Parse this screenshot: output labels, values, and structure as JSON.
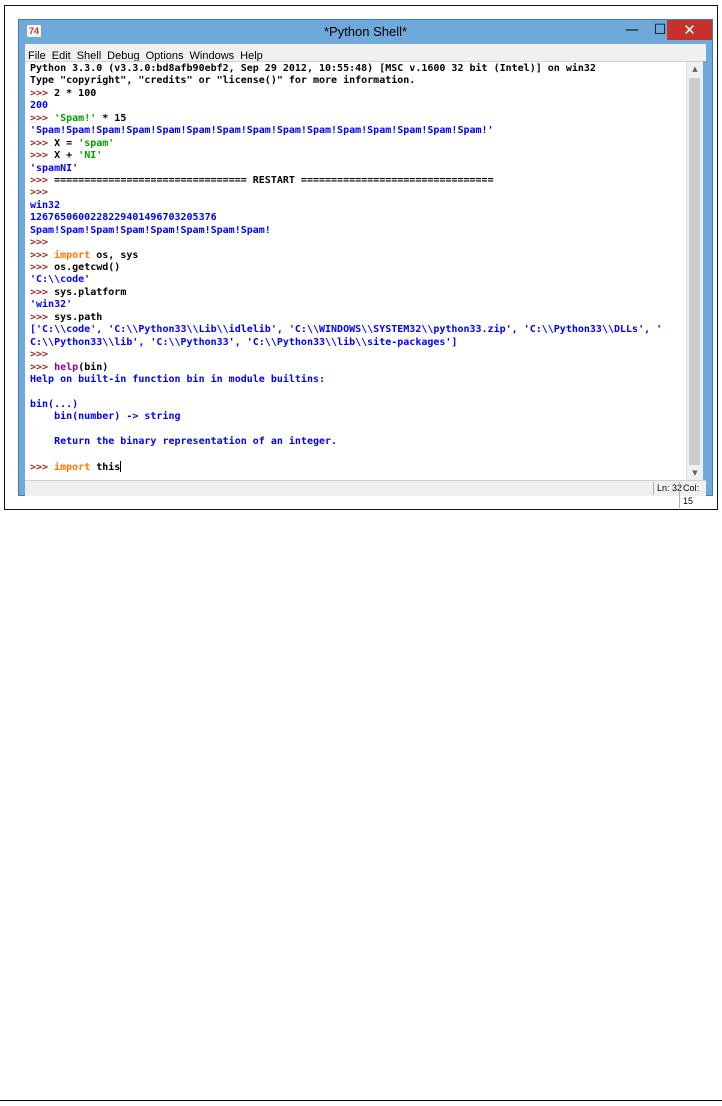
{
  "window": {
    "title": "*Python Shell*",
    "icon_label": "74",
    "controls": {
      "minimize": "—",
      "maximize": "☐",
      "close": "✕"
    }
  },
  "menu": [
    "File",
    "Edit",
    "Shell",
    "Debug",
    "Options",
    "Windows",
    "Help"
  ],
  "shell": {
    "lines": [
      [
        {
          "c": "t",
          "t": "Python 3.3.0 (v3.3.0:bd8afb90ebf2, Sep 29 2012, 10:55:48) [MSC v.1600 32 bit (Intel)] on win32"
        }
      ],
      [
        {
          "c": "t",
          "t": "Type \"copyright\", \"credits\" or \"license()\" for more information."
        }
      ],
      [
        {
          "c": "p",
          "t": ">>> "
        },
        {
          "c": "t",
          "t": "2 * 100"
        }
      ],
      [
        {
          "c": "o",
          "t": "200"
        }
      ],
      [
        {
          "c": "p",
          "t": ">>> "
        },
        {
          "c": "s",
          "t": "'Spam!'"
        },
        {
          "c": "t",
          "t": " * 15"
        }
      ],
      [
        {
          "c": "o",
          "t": "'Spam!Spam!Spam!Spam!Spam!Spam!Spam!Spam!Spam!Spam!Spam!Spam!Spam!Spam!Spam!'"
        }
      ],
      [
        {
          "c": "p",
          "t": ">>> "
        },
        {
          "c": "t",
          "t": "X = "
        },
        {
          "c": "s",
          "t": "'spam'"
        }
      ],
      [
        {
          "c": "p",
          "t": ">>> "
        },
        {
          "c": "t",
          "t": "X + "
        },
        {
          "c": "s",
          "t": "'NI'"
        }
      ],
      [
        {
          "c": "o",
          "t": "'spamNI'"
        }
      ],
      [
        {
          "c": "p",
          "t": ">>> "
        },
        {
          "c": "t",
          "t": "================================ RESTART ================================"
        }
      ],
      [
        {
          "c": "p",
          "t": ">>> "
        }
      ],
      [
        {
          "c": "o",
          "t": "win32"
        }
      ],
      [
        {
          "c": "o",
          "t": "1267650600228229401496703205376"
        }
      ],
      [
        {
          "c": "o",
          "t": "Spam!Spam!Spam!Spam!Spam!Spam!Spam!Spam!"
        }
      ],
      [
        {
          "c": "p",
          "t": ">>> "
        }
      ],
      [
        {
          "c": "p",
          "t": ">>> "
        },
        {
          "c": "k",
          "t": "import"
        },
        {
          "c": "t",
          "t": " os, sys"
        }
      ],
      [
        {
          "c": "p",
          "t": ">>> "
        },
        {
          "c": "t",
          "t": "os.getcwd()"
        }
      ],
      [
        {
          "c": "o",
          "t": "'C:\\\\code'"
        }
      ],
      [
        {
          "c": "p",
          "t": ">>> "
        },
        {
          "c": "t",
          "t": "sys.platform"
        }
      ],
      [
        {
          "c": "o",
          "t": "'win32'"
        }
      ],
      [
        {
          "c": "p",
          "t": ">>> "
        },
        {
          "c": "t",
          "t": "sys.path"
        }
      ],
      [
        {
          "c": "o",
          "t": "['C:\\\\code', 'C:\\\\Python33\\\\Lib\\\\idlelib', 'C:\\\\WINDOWS\\\\SYSTEM32\\\\python33.zip', 'C:\\\\Python33\\\\DLLs', '"
        }
      ],
      [
        {
          "c": "o",
          "t": "C:\\\\Python33\\\\lib', 'C:\\\\Python33', 'C:\\\\Python33\\\\lib\\\\site-packages']"
        }
      ],
      [
        {
          "c": "p",
          "t": ">>> "
        }
      ],
      [
        {
          "c": "p",
          "t": ">>> "
        },
        {
          "c": "b",
          "t": "help"
        },
        {
          "c": "t",
          "t": "(bin)"
        }
      ],
      [
        {
          "c": "o",
          "t": "Help on built-in function bin in module builtins:"
        }
      ],
      [
        {
          "c": "o",
          "t": ""
        }
      ],
      [
        {
          "c": "o",
          "t": "bin(...)"
        }
      ],
      [
        {
          "c": "o",
          "t": "    bin(number) -> string"
        }
      ],
      [
        {
          "c": "o",
          "t": ""
        }
      ],
      [
        {
          "c": "o",
          "t": "    Return the binary representation of an integer."
        }
      ],
      [
        {
          "c": "o",
          "t": ""
        }
      ],
      [
        {
          "c": "p",
          "t": ">>> "
        },
        {
          "c": "k",
          "t": "import"
        },
        {
          "c": "t",
          "t": " this"
        },
        {
          "c": "cursor",
          "t": ""
        }
      ]
    ]
  },
  "status": {
    "line": "Ln: 32",
    "col": "Col: 15"
  },
  "colors": {
    "prompt": "#a52a2a",
    "output": "#0000ff",
    "string": "#00a000",
    "keyword": "#ff7700",
    "builtin": "#900090",
    "title_bar": "#6ea9d9",
    "close_button": "#c7302b"
  },
  "icons": {
    "app": "idle-app-icon",
    "scroll_up": "scroll-up-arrow-icon",
    "scroll_down": "scroll-down-arrow-icon"
  }
}
